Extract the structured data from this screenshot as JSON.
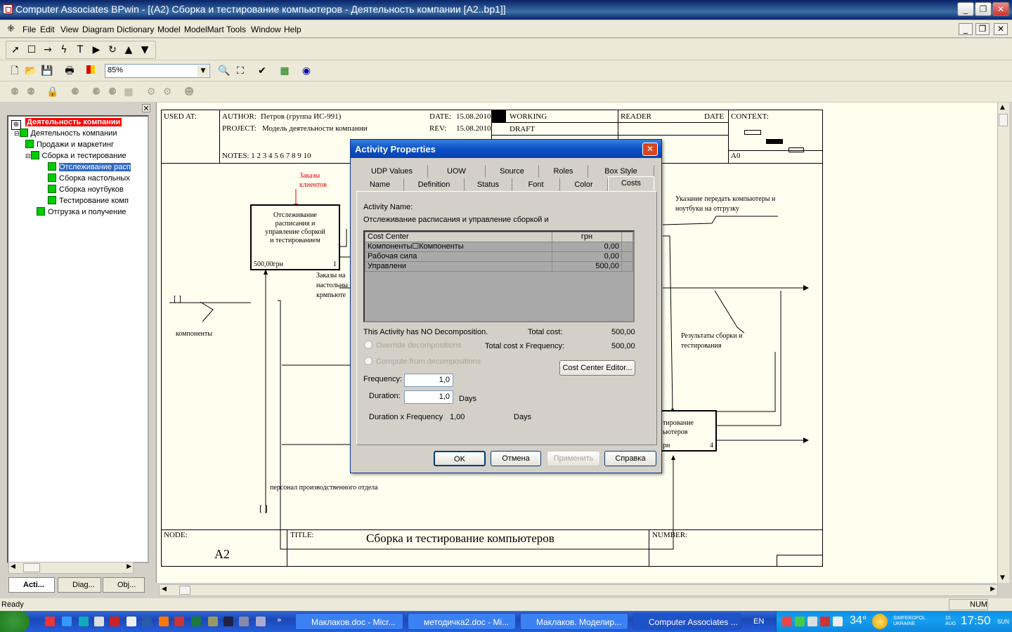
{
  "window": {
    "title": "Computer Associates BPwin - [(A2) Сборка и тестирование  компьютеров - Деятельность компании  [A2..bp1]]"
  },
  "menu": [
    "File",
    "Edit",
    "View",
    "Diagram",
    "Dictionary",
    "Model",
    "ModelMart",
    "Tools",
    "Window",
    "Help"
  ],
  "toolbar": {
    "zoom": "85%"
  },
  "tree": {
    "items": [
      {
        "label": "Деятельность компании",
        "level": 0
      },
      {
        "label": "Деятельность компании",
        "level": 1
      },
      {
        "label": "Продажи и маркетинг",
        "level": 2
      },
      {
        "label": "Сборка и тестирование",
        "level": 2
      },
      {
        "label": "Отслеживание расп",
        "level": 3
      },
      {
        "label": "Сборка настольных",
        "level": 3
      },
      {
        "label": "Сборка ноутбуков",
        "level": 3
      },
      {
        "label": "Тестирование  комп",
        "level": 3
      },
      {
        "label": "Отгрузка и получение",
        "level": 2
      }
    ],
    "tabs": [
      "Acti...",
      "Diag...",
      "Obj..."
    ]
  },
  "diagram": {
    "used_at": "USED AT:",
    "author_label": "AUTHOR:",
    "author": "Петров (группа ИС-991)",
    "project_label": "PROJECT:",
    "project": "Модель деятельности компании",
    "date_label": "DATE:",
    "date": "15.08.2010",
    "rev_label": "REV:",
    "rev": "15.08.2010",
    "working": "WORKING",
    "draft": "DRAFT",
    "reader": "READER",
    "date2": "DATE",
    "context": "CONTEXT:",
    "a0": "A0",
    "notes": "NOTES:  1  2  3  4  5  6  7  8  9  10",
    "zakazy_klientov": "Заказы клиентов",
    "act1": "Отслеживание расписания и управление сборкой и тестированием",
    "act1_cost": "500,00грн",
    "act1_num": "1",
    "zakazy_nastol": "Заказы на настольны крмпьюте",
    "komponenty": "компоненты",
    "ukazanie": "Указание передать компьютеры и ноутбуки на отгрузку",
    "results": "Результаты сборки и тестирования",
    "act4_text": "тирование ьютеров",
    "act4_cost": "рн",
    "act4_num": "4",
    "personal": "персонал производственного отдела",
    "node_label": "NODE:",
    "node": "A2",
    "title_label": "TITLE:",
    "title": "Сборка и тестирование  компьютеров",
    "number_label": "NUMBER:"
  },
  "dialog": {
    "title": "Activity Properties",
    "tabs_row1": [
      "UDP Values",
      "UOW",
      "Source",
      "Roles",
      "Box Style"
    ],
    "tabs_row2": [
      "Name",
      "Definition",
      "Status",
      "Font",
      "Color",
      "Costs"
    ],
    "activity_name_label": "Activity Name:",
    "activity_name": "Отслеживание  расписания и  управление  сборкой и",
    "table_header": [
      "Cost Center",
      "грн"
    ],
    "rows": [
      {
        "name": "Компоненты☐Компоненты",
        "value": "0,00"
      },
      {
        "name": "Рабочая сила",
        "value": "0,00"
      },
      {
        "name": "Управлени",
        "value": "500,00"
      }
    ],
    "no_decomp": "This Activity has NO Decomposition.",
    "total_cost_label": "Total cost:",
    "total_cost": "500,00",
    "override": "Override decompositions",
    "total_freq_label": "Total cost x Frequency:",
    "total_freq": "500,00",
    "compute": "Compute from decompositions",
    "cost_center_editor": "Cost Center Editor...",
    "frequency_label": "Frequency:",
    "frequency": "1,0",
    "duration_label": "Duration:",
    "duration": "1,0",
    "days": "Days",
    "dur_freq_label": "Duration x Frequency",
    "dur_freq": "1,00",
    "days2": "Days",
    "ok": "OK",
    "cancel": "Отмена",
    "apply": "Применить",
    "help": "Справка"
  },
  "status": {
    "text": "Ready",
    "num": "NUM"
  },
  "taskbar": {
    "tasks": [
      "Маклаков.doc - Micr...",
      "методичка2.doc - Mi...",
      "Маклаков. Моделир...",
      "Computer Associates ..."
    ],
    "lang": "EN",
    "temp": "34°",
    "city": "SIMFEROPOL UKRAINE",
    "date": "15 AUG",
    "time": "17:50",
    "day": "SUN"
  }
}
